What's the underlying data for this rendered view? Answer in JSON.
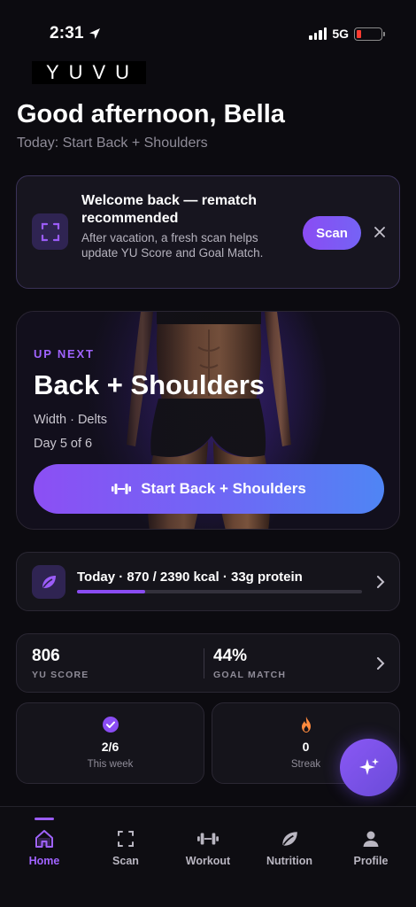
{
  "status_bar": {
    "time": "2:31",
    "network": "5G"
  },
  "logo": {
    "text": "YUVU"
  },
  "greeting": "Good afternoon, Bella",
  "subtitle": "Today: Start Back + Shoulders",
  "welcome_card": {
    "title": "Welcome back — rematch recommended",
    "description": "After vacation, a fresh scan helps update YU Score and Goal Match.",
    "scan_label": "Scan",
    "icon": "scan-frame-icon"
  },
  "hero": {
    "eyebrow": "UP NEXT",
    "title": "Back + Shoulders",
    "meta": "Width · Delts",
    "day": "Day 5 of 6",
    "button_label": "Start Back + Shoulders"
  },
  "nutrition": {
    "text": "Today · 870 / 2390 kcal · 33g protein",
    "kcal": 870,
    "kcal_goal": 2390,
    "progress_fraction": 0.24
  },
  "scores": {
    "yu_score_value": "806",
    "yu_score_label": "YU SCORE",
    "goal_match_value": "44%",
    "goal_match_label": "GOAL MATCH"
  },
  "this_week": {
    "value": "2/6",
    "label": "This week"
  },
  "streak": {
    "value": "0",
    "label": "Streak"
  },
  "tabs": [
    {
      "label": "Home",
      "icon": "home-icon",
      "active": true
    },
    {
      "label": "Scan",
      "icon": "scan-icon",
      "active": false
    },
    {
      "label": "Workout",
      "icon": "dumbbell-icon",
      "active": false
    },
    {
      "label": "Nutrition",
      "icon": "leaf-icon",
      "active": false
    },
    {
      "label": "Profile",
      "icon": "person-icon",
      "active": false
    }
  ],
  "colors": {
    "accent": "#9b5cf8",
    "background": "#0c0b10",
    "card": "#15141b",
    "streak_flame": "#ff8a3d"
  }
}
